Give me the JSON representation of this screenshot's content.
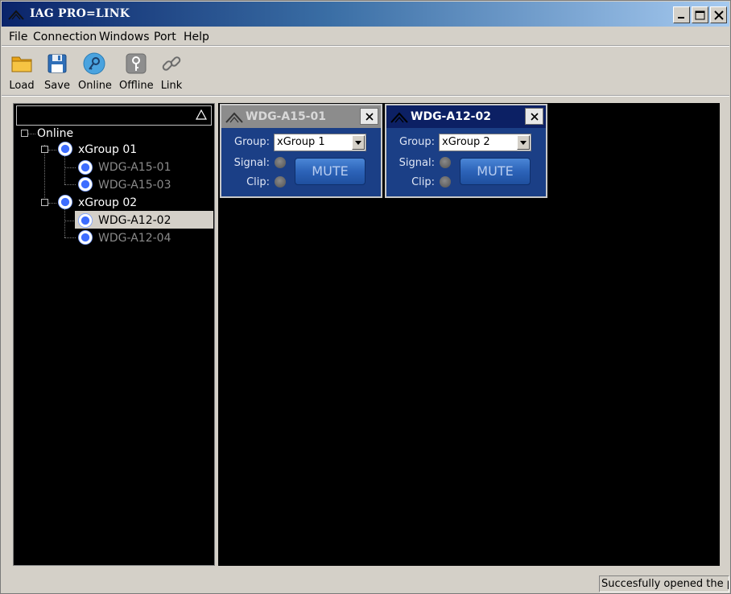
{
  "window": {
    "title": "IAG PRO=LINK"
  },
  "menu": [
    "File",
    "Connection",
    "Windows",
    "Port",
    "Help"
  ],
  "toolbar": [
    {
      "label": "Load",
      "icon": "folder-icon"
    },
    {
      "label": "Save",
      "icon": "floppy-disk-icon"
    },
    {
      "label": "Online",
      "icon": "online-icon"
    },
    {
      "label": "Offline",
      "icon": "offline-icon"
    },
    {
      "label": "Link",
      "icon": "chain-link-icon"
    }
  ],
  "tree": {
    "root": "Online",
    "groups": [
      {
        "label": "xGroup 01",
        "devices": [
          "WDG-A15-01",
          "WDG-A15-03"
        ]
      },
      {
        "label": "xGroup 02",
        "devices": [
          "WDG-A12-02",
          "WDG-A12-04"
        ]
      }
    ],
    "selected": "WDG-A12-02"
  },
  "panels": [
    {
      "name": "WDG-A15-01",
      "active": false,
      "group_label": "Group:",
      "group_value": "xGroup 1",
      "signal_label": "Signal:",
      "clip_label": "Clip:",
      "mute_label": "MUTE"
    },
    {
      "name": "WDG-A12-02",
      "active": true,
      "group_label": "Group:",
      "group_value": "xGroup 2",
      "signal_label": "Signal:",
      "clip_label": "Clip:",
      "mute_label": "MUTE"
    }
  ],
  "status": {
    "text": "Succesfully opened the port"
  },
  "colors": {
    "title_gradient_start": "#0a246a",
    "panel_body": "#1b3f86",
    "active_header": "#0c2064",
    "inactive_header": "#8c8c8c",
    "mute_button": "#2c63b8"
  }
}
